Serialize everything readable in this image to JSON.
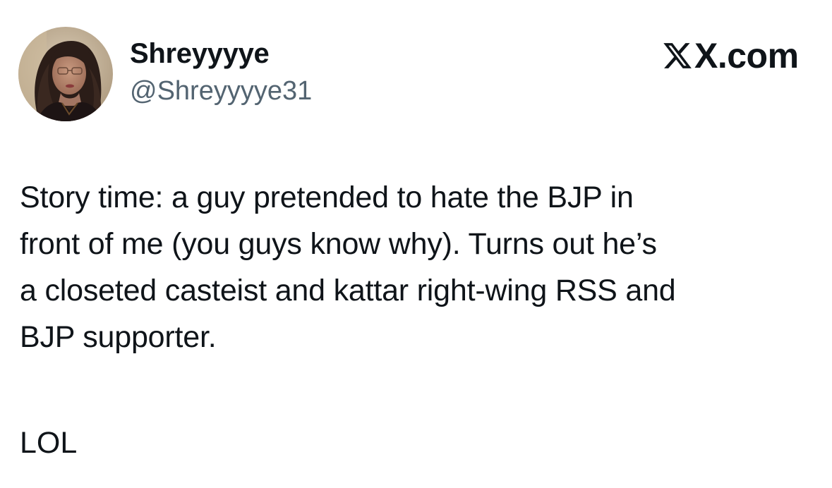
{
  "author": {
    "display_name": "Shreyyyye",
    "handle": "@Shreyyyye31"
  },
  "brand": {
    "label": "X.com",
    "icon": "x-logo-icon"
  },
  "tweet": {
    "lines": [
      "Story time: a guy pretended to hate the BJP in",
      "front of me (you guys know why). Turns out he’s",
      "a closeted casteist and kattar right-wing RSS and",
      "BJP supporter."
    ],
    "tail": "LOL"
  },
  "colors": {
    "text_primary": "#0f1419",
    "text_secondary": "#536471",
    "background": "#ffffff"
  }
}
